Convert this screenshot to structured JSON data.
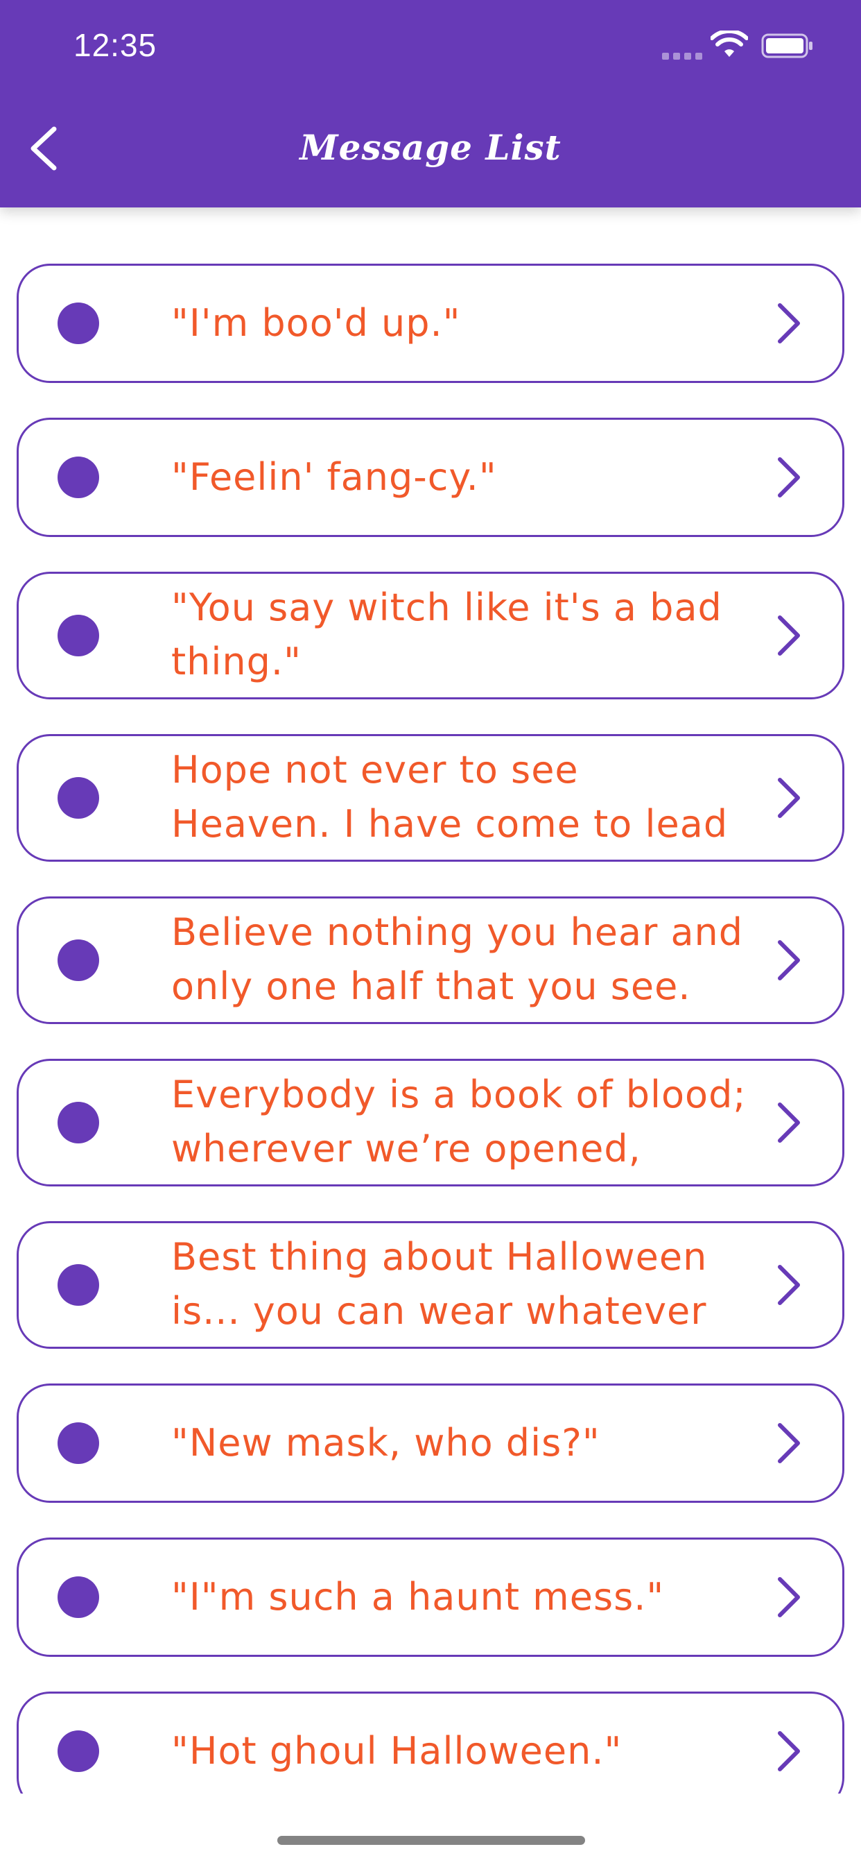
{
  "status_bar": {
    "time": "12:35"
  },
  "header": {
    "title": "Message List",
    "back_icon": "chevron-left-icon"
  },
  "colors": {
    "brand": "#673ab7",
    "text": "#f1592a",
    "background": "#ffffff"
  },
  "messages": [
    {
      "text": "\"I'm boo'd up.\""
    },
    {
      "text": "\"Feelin' fang-cy.\""
    },
    {
      "text": "\"You say witch like it's a bad thing.\""
    },
    {
      "text": "Hope not ever to see Heaven. I have come to lead you to"
    },
    {
      "text": "Believe nothing you hear and only one half that you see."
    },
    {
      "text": "Everybody is a book of blood; wherever we’re opened, we’re"
    },
    {
      "text": "Best thing about Halloween is... you can wear whatever"
    },
    {
      "text": "\"New mask, who dis?\""
    },
    {
      "text": "\"I\"m such a haunt mess.\""
    },
    {
      "text": "\"Hot ghoul Halloween.\""
    }
  ]
}
